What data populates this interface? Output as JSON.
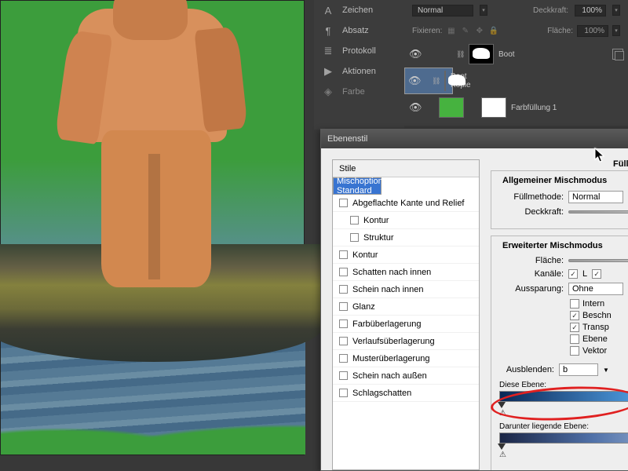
{
  "sidebar": {
    "items": [
      {
        "icon": "A|",
        "label": "Zeichen"
      },
      {
        "icon": "¶",
        "label": "Absatz"
      },
      {
        "icon": "≣",
        "label": "Protokoll"
      },
      {
        "icon": "▶",
        "label": "Aktionen"
      },
      {
        "icon": "◈",
        "label": "Farbe"
      }
    ]
  },
  "layers": {
    "blend_mode": "Normal",
    "opacity_label": "Deckkraft:",
    "opacity": "100%",
    "lock_label": "Fixieren:",
    "fill_label": "Fläche:",
    "fill": "100%",
    "items": [
      {
        "name": "Boot"
      },
      {
        "name": "Boot Kopie"
      },
      {
        "name": "Farbfüllung 1"
      }
    ]
  },
  "dialog": {
    "title": "Ebenenstil",
    "styles_header": "Stile",
    "styles": [
      {
        "label": "Mischoptionen: Standard",
        "selected": true,
        "cb": false
      },
      {
        "label": "Abgeflachte Kante und Relief",
        "cb": true
      },
      {
        "label": "Kontur",
        "cb": true,
        "indent": true
      },
      {
        "label": "Struktur",
        "cb": true,
        "indent": true
      },
      {
        "label": "Kontur",
        "cb": true
      },
      {
        "label": "Schatten nach innen",
        "cb": true
      },
      {
        "label": "Schein nach innen",
        "cb": true
      },
      {
        "label": "Glanz",
        "cb": true
      },
      {
        "label": "Farbüberlagerung",
        "cb": true
      },
      {
        "label": "Verlaufsüberlagerung",
        "cb": true
      },
      {
        "label": "Musterüberlagerung",
        "cb": true
      },
      {
        "label": "Schein nach außen",
        "cb": true
      },
      {
        "label": "Schlagschatten",
        "cb": true
      }
    ],
    "opts": {
      "section_title": "Fülloptionen",
      "group1_title": "Allgemeiner Mischmodus",
      "blend_label": "Füllmethode:",
      "blend_value": "Normal",
      "opacity_label": "Deckkraft:",
      "group2_title": "Erweiterter Mischmodus",
      "fill_label": "Fläche:",
      "channels_label": "Kanäle:",
      "ch_l": "L",
      "knockout_label": "Aussparung:",
      "knockout_value": "Ohne",
      "cb_internal": "Intern",
      "cb_beschn": "Beschn",
      "cb_transp": "Transp",
      "cb_ebene": "Ebene",
      "cb_vektor": "Vektor",
      "blend_if_label": "Ausblenden:",
      "blend_if_value": "b",
      "this_layer": "Diese Ebene:",
      "this_val": "0",
      "under_layer": "Darunter liegende Ebene:",
      "under_val": "0"
    }
  }
}
